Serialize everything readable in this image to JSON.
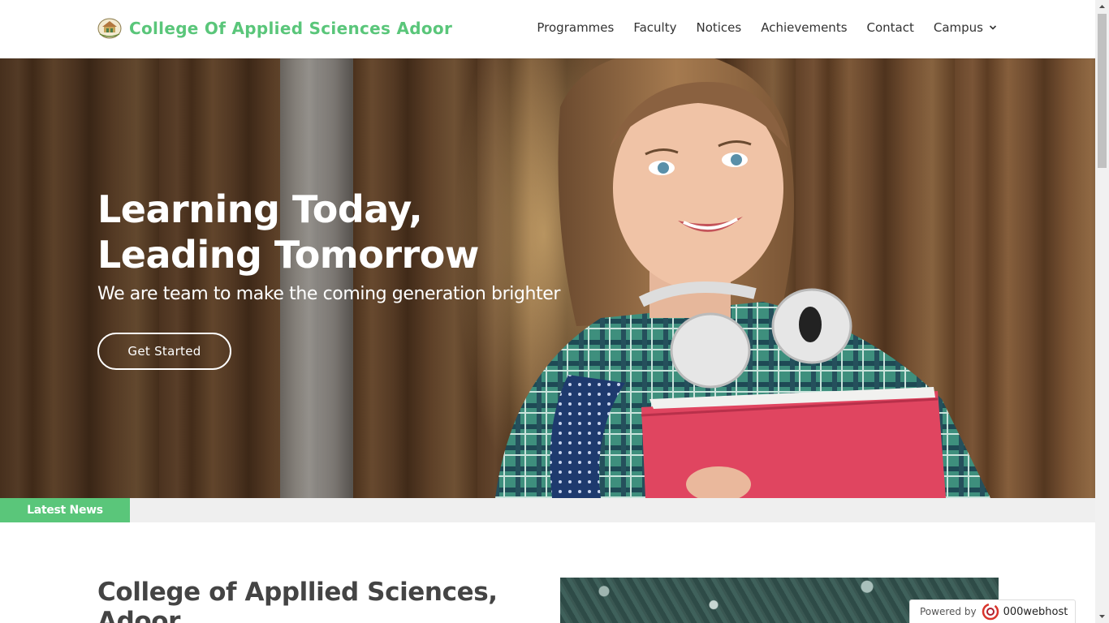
{
  "header": {
    "brand_name": "College Of Applied Sciences Adoor",
    "logo_icon": "college-emblem-icon",
    "brand_color": "#5ac67a",
    "nav": [
      {
        "label": "Programmes"
      },
      {
        "label": "Faculty"
      },
      {
        "label": "Notices"
      },
      {
        "label": "Achievements"
      },
      {
        "label": "Contact"
      },
      {
        "label": "Campus",
        "icon": "chevron-down-icon"
      }
    ]
  },
  "hero": {
    "title_line1": "Learning Today,",
    "title_line2": "Leading Tomorrow",
    "subtitle": "We are team to make the coming generation brighter",
    "cta_label": "Get Started"
  },
  "news": {
    "label": "Latest News",
    "label_bg": "#5ac67a"
  },
  "about": {
    "title": "College of Appllied Sciences, Adoor"
  },
  "badge": {
    "prefix": "Powered by",
    "brand": "000webhost",
    "icon": "000webhost-logo-icon"
  }
}
